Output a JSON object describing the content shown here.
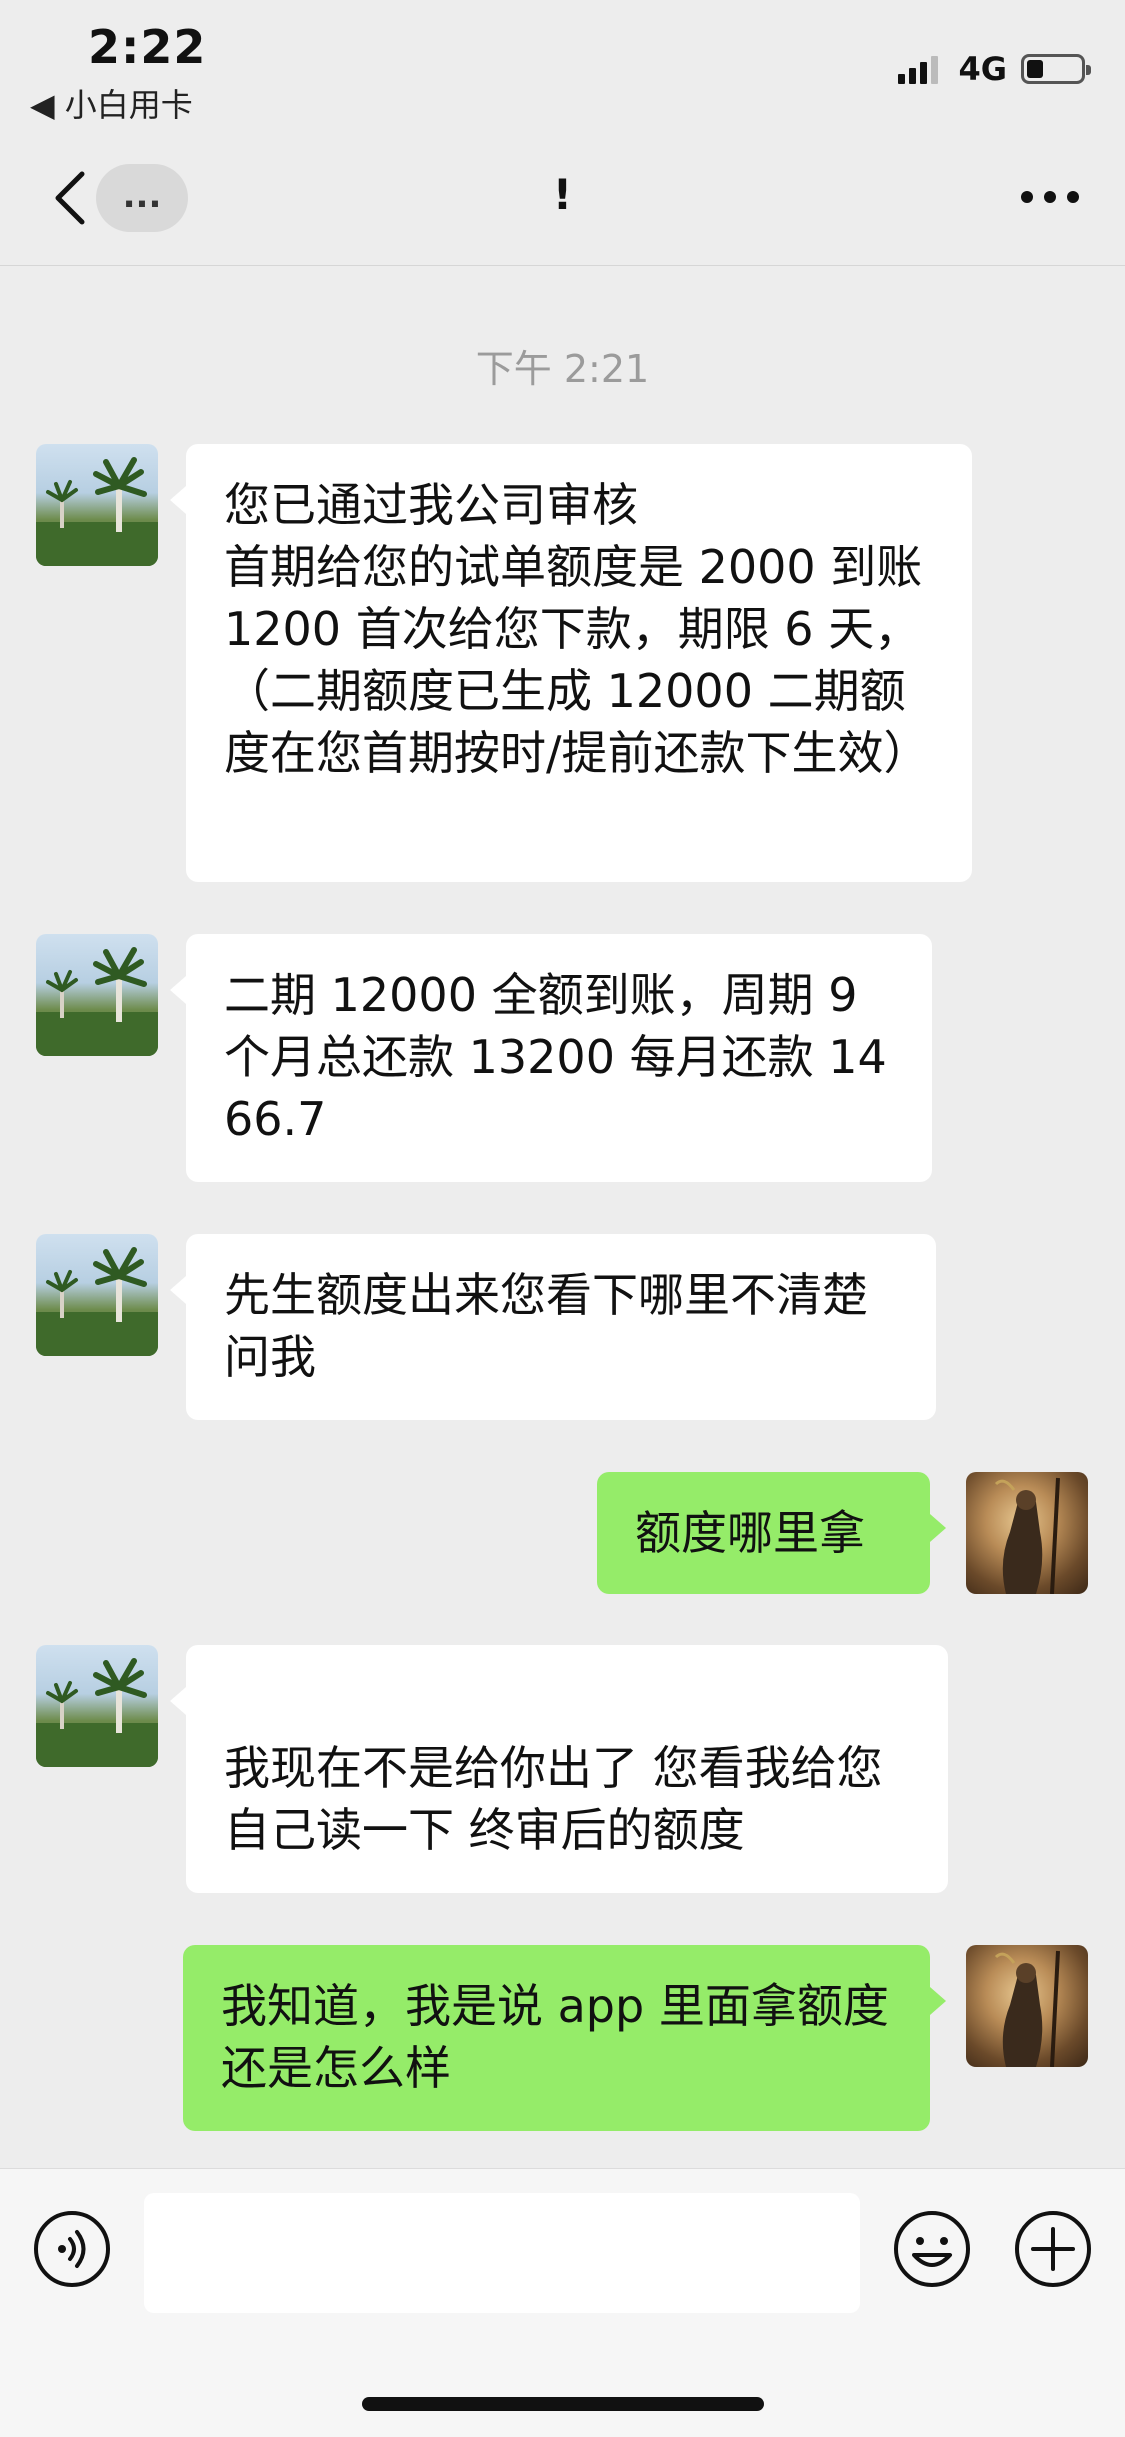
{
  "status_bar": {
    "time": "2:22",
    "back_app": "◀ 小白用卡",
    "network": "4G",
    "battery_level": 0.3
  },
  "nav": {
    "unread_label": "...",
    "title": "!",
    "back_icon": "chevron-left-icon",
    "more_icon": "more-horizontal-icon"
  },
  "chat": {
    "timestamp": "下午 2:21",
    "messages": [
      {
        "side": "in",
        "text": "您已通过我公司审核\n首期给您的试单额度是 2000 到账 1200 首次给您下款，期限 6 天，（二期额度已生成 12000 二期额度在您首期按时/提前还款下生效）"
      },
      {
        "side": "in",
        "text": "二期 12000 全额到账，周期 9 个月总还款 13200 每月还款 1466.7"
      },
      {
        "side": "in",
        "text": "先生额度出来您看下哪里不清楚问我"
      },
      {
        "side": "out",
        "text": "额度哪里拿"
      },
      {
        "side": "in",
        "text": "\n我现在不是给你出了 您看我给您 自己读一下 终审后的额度"
      },
      {
        "side": "out",
        "text": "我知道，我是说 app 里面拿额度还是怎么样"
      }
    ]
  },
  "input_bar": {
    "placeholder": "",
    "icons": [
      "voice-icon",
      "emoji-icon",
      "plus-icon"
    ]
  },
  "colors": {
    "background": "#ededed",
    "outgoing_bubble": "#95ec69",
    "incoming_bubble": "#ffffff",
    "timestamp": "#9b9b9b"
  }
}
